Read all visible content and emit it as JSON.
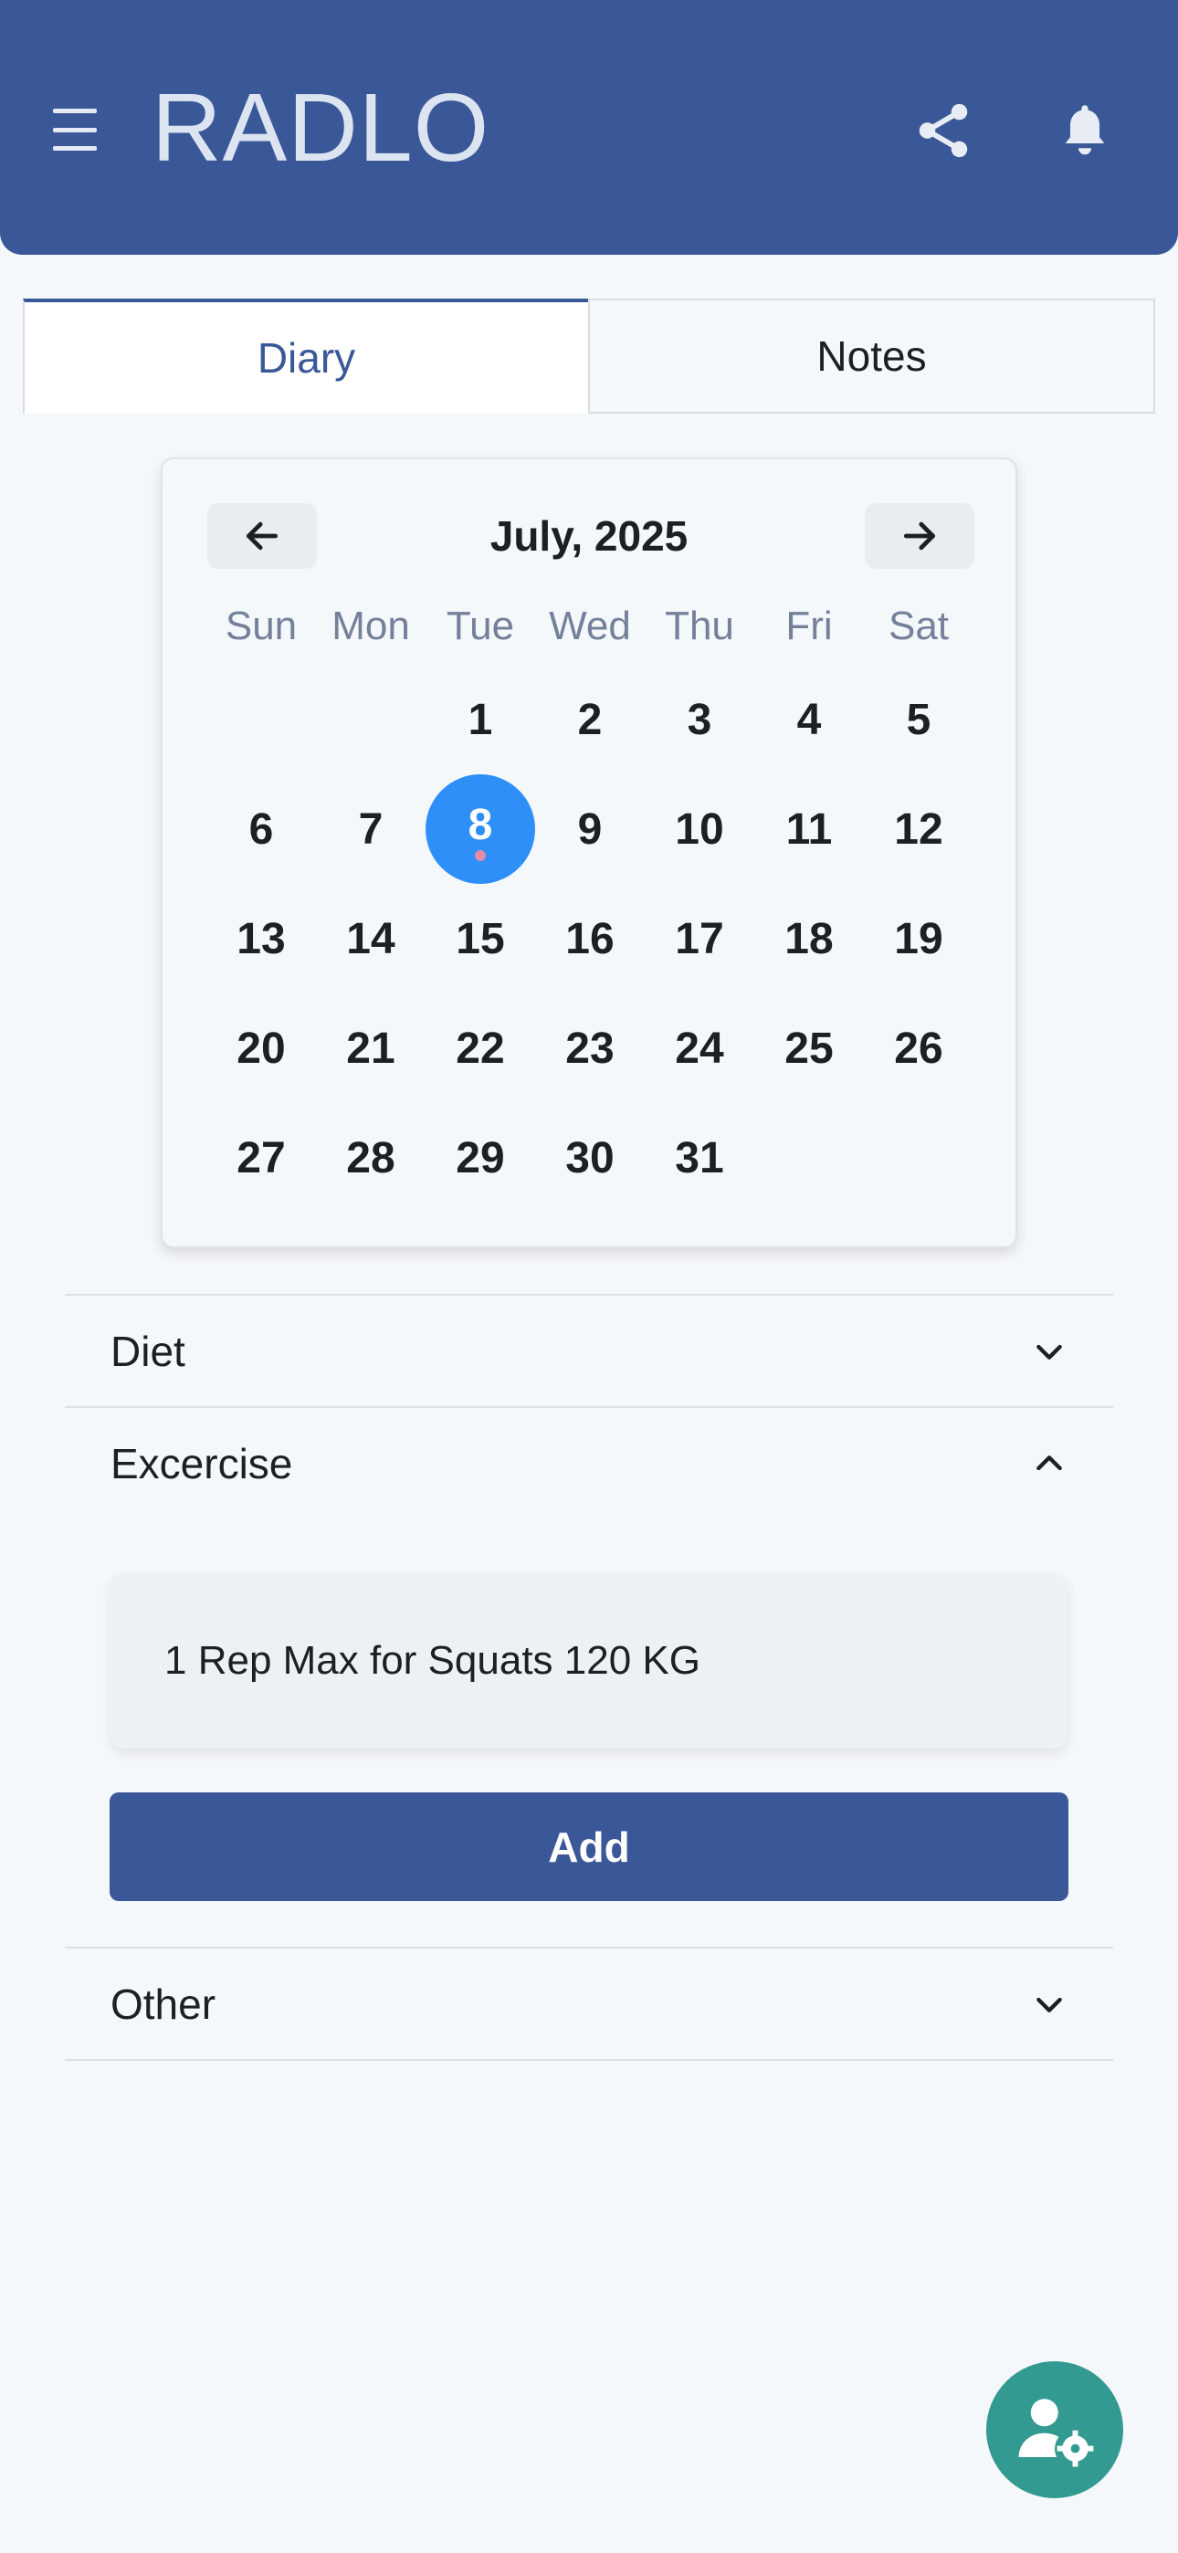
{
  "header": {
    "app_title": "RADLO",
    "menu_icon": "hamburger-menu-icon",
    "share_icon": "share-icon",
    "notification_icon": "bell-icon"
  },
  "tabs": [
    {
      "label": "Diary",
      "active": true
    },
    {
      "label": "Notes",
      "active": false
    }
  ],
  "calendar": {
    "month_label": "July, 2025",
    "weekdays": [
      "Sun",
      "Mon",
      "Tue",
      "Wed",
      "Thu",
      "Fri",
      "Sat"
    ],
    "selected_day": 8,
    "weeks": [
      [
        "",
        "",
        "1",
        "2",
        "3",
        "4",
        "5"
      ],
      [
        "6",
        "7",
        "8",
        "9",
        "10",
        "11",
        "12"
      ],
      [
        "13",
        "14",
        "15",
        "16",
        "17",
        "18",
        "19"
      ],
      [
        "20",
        "21",
        "22",
        "23",
        "24",
        "25",
        "26"
      ],
      [
        "27",
        "28",
        "29",
        "30",
        "31",
        "",
        ""
      ]
    ]
  },
  "sections": {
    "diet": {
      "label": "Diet",
      "expanded": false
    },
    "exercise": {
      "label": "Excercise",
      "expanded": true,
      "entries": [
        "1 Rep Max for Squats 120 KG"
      ],
      "add_label": "Add"
    },
    "other": {
      "label": "Other",
      "expanded": false
    }
  },
  "fab": {
    "icon": "user-settings-icon"
  },
  "colors": {
    "brand": "#3a5897",
    "selected_day": "#2e8ff8",
    "fab": "#329a91",
    "background": "#f5f8fb"
  }
}
